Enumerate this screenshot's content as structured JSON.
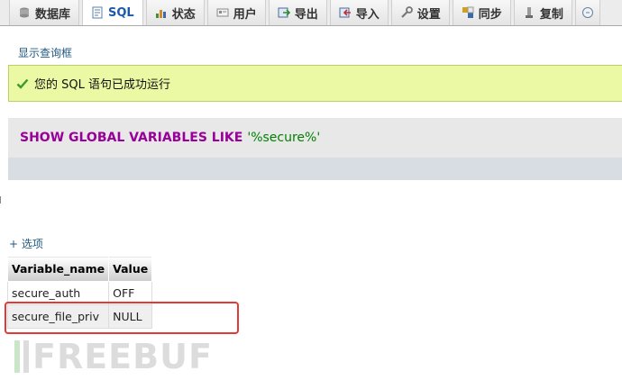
{
  "tabs": [
    {
      "label": "数据库",
      "icon": "database-icon",
      "active": false
    },
    {
      "label": "SQL",
      "icon": "sql-icon",
      "active": true
    },
    {
      "label": "状态",
      "icon": "status-icon",
      "active": false
    },
    {
      "label": "用户",
      "icon": "users-icon",
      "active": false
    },
    {
      "label": "导出",
      "icon": "export-icon",
      "active": false
    },
    {
      "label": "导入",
      "icon": "import-icon",
      "active": false
    },
    {
      "label": "设置",
      "icon": "settings-icon",
      "active": false
    },
    {
      "label": "同步",
      "icon": "sync-icon",
      "active": false
    },
    {
      "label": "复制",
      "icon": "replication-icon",
      "active": false
    }
  ],
  "query_box_link": "显示查询框",
  "success_message": "您的 SQL 语句已成功运行",
  "sql": {
    "keywords": "SHOW GLOBAL VARIABLES LIKE",
    "string": "'%secure%'"
  },
  "options_link": "+ 选项",
  "table": {
    "headers": [
      "Variable_name",
      "Value"
    ],
    "rows": [
      [
        "secure_auth",
        "OFF"
      ],
      [
        "secure_file_priv",
        "NULL"
      ]
    ]
  },
  "watermark": "FREEBUF",
  "colors": {
    "success_bg": "#ebf8a4",
    "keyword": "#990099",
    "string": "#008000",
    "highlight_border": "#e53935",
    "link": "#235a81"
  }
}
